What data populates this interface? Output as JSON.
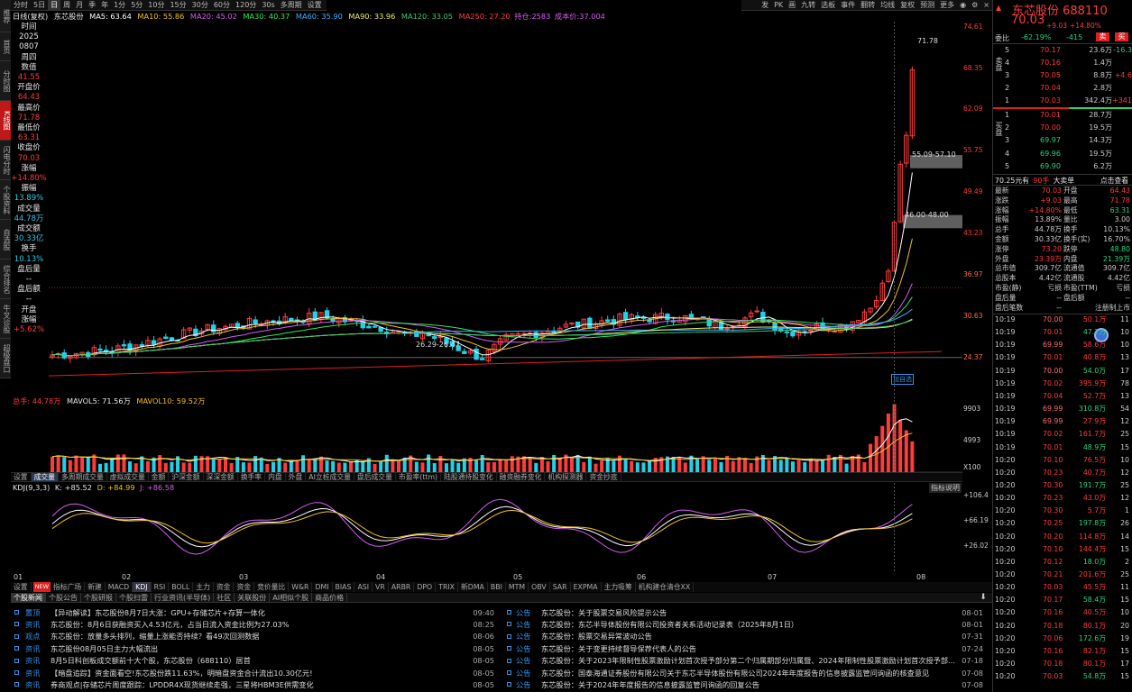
{
  "left_tabs": [
    "推荐",
    "首页",
    "分时图",
    "K线图",
    "闪电分时",
    "个股资料",
    "自选股",
    "综合排名",
    "牛叉诊股",
    "超级盘口"
  ],
  "period_bar": [
    "分时",
    "5日",
    "日",
    "周",
    "月",
    "季",
    "年",
    "1分",
    "5分",
    "10分",
    "15分",
    "30分",
    "60分",
    "120分",
    "30s",
    "多周期",
    "设置"
  ],
  "right_tools": [
    "发",
    "PK",
    "画",
    "九转",
    "选板",
    "事件",
    "翻转",
    "均线",
    "复权",
    "预测",
    "更多"
  ],
  "ma_line": {
    "label": "日线(复权)",
    "name": "东芯股份",
    "ma5": "MA5: 63.64",
    "ma10": "MA10: 55.86",
    "ma20": "MA20: 45.02",
    "ma30": "MA30: 40.37",
    "ma60": "MA60: 35.90",
    "ma90": "MA90: 33.96",
    "ma120": "MA120: 33.05",
    "ma250": "MA250: 27.20",
    "hold": "持仓:2583",
    "cost": "成本价:37.004"
  },
  "left_info": [
    [
      "时间",
      "wht"
    ],
    [
      "2025",
      "wht"
    ],
    [
      "0807",
      "wht"
    ],
    [
      "周四",
      "wht"
    ],
    [
      "数值",
      "wht"
    ],
    [
      "41.55",
      "red"
    ],
    [
      "开盘价",
      "wht"
    ],
    [
      "64.43",
      "red"
    ],
    [
      "最高价",
      "wht"
    ],
    [
      "71.78",
      "red"
    ],
    [
      "最低价",
      "wht"
    ],
    [
      "63.31",
      "red"
    ],
    [
      "收盘价",
      "wht"
    ],
    [
      "70.03",
      "red"
    ],
    [
      "涨幅",
      "wht"
    ],
    [
      "+14.80%",
      "red"
    ],
    [
      "振幅",
      "wht"
    ],
    [
      "13.89%",
      "cyan"
    ],
    [
      "成交量",
      "wht"
    ],
    [
      "44.78万",
      "cyan"
    ],
    [
      "成交额",
      "wht"
    ],
    [
      "30.33亿",
      "cyan"
    ],
    [
      "换手",
      "wht"
    ],
    [
      "10.13%",
      "cyan"
    ],
    [
      "盘后量",
      "wht"
    ],
    [
      "--",
      "wht"
    ],
    [
      "盘后额",
      "wht"
    ],
    [
      "--",
      "wht"
    ],
    [
      "开盘",
      "wht"
    ],
    [
      "涨幅",
      "wht"
    ],
    [
      "+5.62%",
      "red"
    ]
  ],
  "price_axis": [
    "74.61",
    "68.35",
    "62.09",
    "55.75",
    "49.49",
    "43.23",
    "36.97",
    "30.63",
    "24.37"
  ],
  "zones": {
    "z1": "55.09-57.10",
    "z2": "46.00-48.00",
    "low": "26.29-26.47",
    "high": "71.78",
    "marker": "加自选"
  },
  "vol_header": {
    "total": "总手: 44.78万",
    "mavol5": "MAVOL5: 71.56万",
    "mavol10": "MAVOL10: 59.52万"
  },
  "vol_axis": [
    "9903",
    "4993",
    "X100"
  ],
  "ind_tabs": [
    "设置",
    "成交量",
    "多周期成交量",
    "虚拟成交量",
    "金额",
    "沪深金额",
    "深深金额",
    "换手率",
    "内盘",
    "外盘",
    "AI立桩成交量",
    "盘后成交量",
    "市盈率(ttm)",
    "陆股通持股变化",
    "融资融券变化",
    "机构探测器",
    "资金抄底"
  ],
  "kdj_header": {
    "name": "KDJ(9,3,3)",
    "k": "K: +85.52",
    "d": "D: +84.99",
    "j": "J: +86.58",
    "help": "指标说明"
  },
  "kdj_axis": [
    "+106.4",
    "+66.19",
    "+26.02"
  ],
  "months": [
    "01",
    "02",
    "03",
    "04",
    "05",
    "06",
    "07",
    "08"
  ],
  "ind_tabs2": [
    "设置",
    "指标广场",
    "新建",
    "MACD",
    "KDJ",
    "RSI",
    "BOLL",
    "主力",
    "资金",
    "资金",
    "竞价量比",
    "W&R",
    "DMI",
    "BIAS",
    "ASI",
    "VR",
    "ARBR",
    "DPO",
    "TRIX",
    "新DMA",
    "BBI",
    "MTM",
    "OBV",
    "SAR",
    "EXPMA",
    "主力吸筹",
    "机构建仓清仓XX"
  ],
  "new_badge": "NEW",
  "news_tabs": [
    "个股新闻",
    "个股公告",
    "个股研报",
    "个股扫雷",
    "行业资讯(半导体)",
    "社区",
    "关联股份",
    "AI相似个股",
    "商品价格"
  ],
  "news_left": [
    [
      "置顶",
      "【异动解读】东芯股份8月7日大涨：GPU+存储芯片+存算一体化",
      "09:40"
    ],
    [
      "资讯",
      "东芯股份：8月6日获融资买入4.53亿元，占当日流入资金比例为27.03%",
      "08:25"
    ],
    [
      "观点",
      "东芯股份：放量多头排列，缩量上涨能否持续？看49次回测数据",
      "08-06"
    ],
    [
      "资讯",
      "东芯股份08月05日主力大幅流出",
      "08-05"
    ],
    [
      "资讯",
      "8月5日科创板成交额前十大个股，东芯股份（688110）居首",
      "08-05"
    ],
    [
      "资讯",
      "【暗盘追踪】资金面看空!东芯股份跌11.63%，明暗盘资金合计流出10.30亿元!",
      "08-05"
    ],
    [
      "资讯",
      "券商观点|存储芯片周度跟踪：LPDDR4X现货继续走强，三星将HBM3E供需变化",
      "08-05"
    ]
  ],
  "news_right": [
    [
      "公告",
      "东芯股份：关于股票交易风险提示公告",
      "08-01"
    ],
    [
      "公告",
      "东芯股份：东芯半导体股份有限公司投资者关系活动记录表（2025年8月1日）",
      "08-01"
    ],
    [
      "公告",
      "东芯股份：股票交易异常波动公告",
      "07-31"
    ],
    [
      "公告",
      "东芯股份：关于变更持续督导保荐代表人的公告",
      "07-24"
    ],
    [
      "公告",
      "东芯股份：关于2023年限制性股票激励计划首次授予部分第二个归属期部分归属暨、2024年限制性股票激励计划首次授予部...",
      "07-18"
    ],
    [
      "公告",
      "东芯股份：国泰海通证券股份有限公司关于东芯半导体股份有限公司2024年年度报告的信息披露监管问询函的核查意见",
      "07-08"
    ],
    [
      "公告",
      "东芯股份：关于2024年年度报告的信息披露监管问询函的回复公告",
      "07-08"
    ]
  ],
  "quote": {
    "name": "东芯股份 688110",
    "price": "70.03",
    "chg": "+9.03",
    "pct": "+14.80%",
    "wb_label": "委比",
    "wb": "-62.19%",
    "wc": "-415",
    "sell_btn": "卖",
    "buy_btn": "买"
  },
  "ask": [
    [
      "5",
      "70.17",
      "23.6万",
      "-16.3"
    ],
    [
      "4",
      "70.16",
      "1.4万",
      ""
    ],
    [
      "3",
      "70.05",
      "8.8万",
      "+4.6"
    ],
    [
      "2",
      "70.04",
      "2.8万",
      ""
    ],
    [
      "1",
      "70.03",
      "342.4万",
      "+341"
    ]
  ],
  "bid": [
    [
      "1",
      "70.01",
      "28.7万",
      ""
    ],
    [
      "2",
      "70.00",
      "19.5万",
      ""
    ],
    [
      "3",
      "69.97",
      "14.3万",
      ""
    ],
    [
      "4",
      "69.96",
      "19.5万",
      ""
    ],
    [
      "5",
      "69.90",
      "6.2万",
      ""
    ]
  ],
  "side_labels": {
    "sell": "卖盘",
    "buy": "买盘"
  },
  "big_order": {
    "a": "70.25元有",
    "b": "90手",
    "c": "大卖单",
    "d": "点击查看"
  },
  "stats": [
    [
      "最新",
      "70.03",
      "开盘",
      "64.43"
    ],
    [
      "涨跌",
      "+9.03",
      "最高",
      "71.78"
    ],
    [
      "涨幅",
      "+14.80%",
      "最低",
      "63.31"
    ],
    [
      "振幅",
      "13.89%",
      "量比",
      "3.00"
    ],
    [
      "总手",
      "44.78万",
      "换手",
      "10.13%"
    ],
    [
      "金额",
      "30.33亿",
      "换手(实)",
      "16.70%"
    ],
    [
      "涨停",
      "73.20",
      "跌停",
      "48.80"
    ],
    [
      "外盘",
      "23.39万",
      "内盘",
      "21.39万"
    ],
    [
      "总市值",
      "309.7亿",
      "流通值",
      "309.7亿"
    ],
    [
      "总股本",
      "4.42亿",
      "流通股",
      "4.42亿"
    ],
    [
      "市盈(静)",
      "亏损",
      "市盈(TTM)",
      "亏损"
    ],
    [
      "盘后量",
      "--",
      "盘后额",
      "--"
    ],
    [
      "盘后笔数",
      "--",
      "",
      "注册制上市"
    ]
  ],
  "ticks": [
    [
      "10:19",
      "70.00",
      "50.1万",
      "11"
    ],
    [
      "10:19",
      "70.01",
      "47.2万",
      "10"
    ],
    [
      "10:19",
      "69.99",
      "58.6万",
      "10"
    ],
    [
      "10:19",
      "70.01",
      "40.8万",
      "13"
    ],
    [
      "10:19",
      "70.00",
      "54.0万",
      "17"
    ],
    [
      "10:19",
      "70.02",
      "395.9万",
      "78"
    ],
    [
      "10:19",
      "70.04",
      "52.7万",
      "13"
    ],
    [
      "10:19",
      "69.99",
      "310.8万",
      "54"
    ],
    [
      "10:19",
      "69.99",
      "27.9万",
      "12"
    ],
    [
      "10:19",
      "70.02",
      "161.7万",
      "25"
    ],
    [
      "10:19",
      "70.01",
      "48.9万",
      "15"
    ],
    [
      "10:20",
      "70.10",
      "76.5万",
      "10"
    ],
    [
      "10:20",
      "70.23",
      "40.7万",
      "12"
    ],
    [
      "10:20",
      "70.30",
      "191.7万",
      "25"
    ],
    [
      "10:20",
      "70.23",
      "43.0万",
      "12"
    ],
    [
      "10:20",
      "70.30",
      "5.7万",
      "1"
    ],
    [
      "10:20",
      "70.25",
      "197.8万",
      "26"
    ],
    [
      "10:20",
      "70.20",
      "114.8万",
      "14"
    ],
    [
      "10:20",
      "70.10",
      "144.4万",
      "15"
    ],
    [
      "10:20",
      "70.12",
      "18.0万",
      "2"
    ],
    [
      "10:20",
      "70.21",
      "201.6万",
      "25"
    ],
    [
      "10:20",
      "70.03",
      "45.5万",
      "11"
    ],
    [
      "10:20",
      "70.17",
      "58.4万",
      "15"
    ],
    [
      "10:20",
      "70.16",
      "40.5万",
      "10"
    ],
    [
      "10:20",
      "70.18",
      "80.1万",
      "20"
    ],
    [
      "10:20",
      "70.06",
      "172.6万",
      "19"
    ],
    [
      "10:20",
      "70.16",
      "82.1万",
      "15"
    ],
    [
      "10:20",
      "70.18",
      "80.1万",
      "17"
    ],
    [
      "10:20",
      "70.03",
      "54.8万",
      "15"
    ]
  ]
}
